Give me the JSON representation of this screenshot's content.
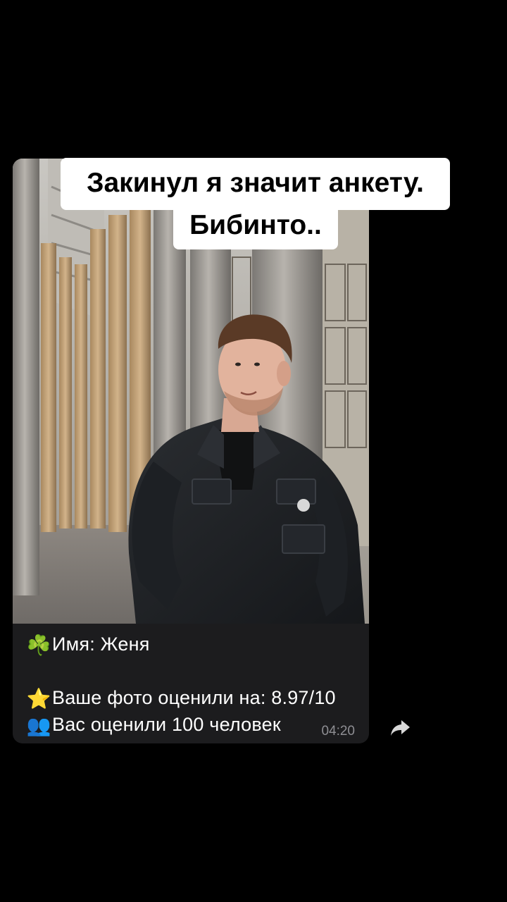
{
  "overlay": {
    "line1": "Закинул я значит анкету.",
    "line2": "Бибинто.."
  },
  "message": {
    "name_icon": "clover-icon",
    "name_emoji": "☘️",
    "name_line": "Имя: Женя",
    "rating_icon": "star-icon",
    "rating_emoji": "⭐",
    "rating_line": "Ваше фото оценили на: 8.97/10",
    "count_icon": "people-icon",
    "count_emoji": "👥",
    "count_line": "Вас оценили 100 человек",
    "time": "04:20"
  },
  "actions": {
    "forward_icon": "forward-arrow-icon"
  },
  "colors": {
    "background": "#000000",
    "bubble": "#1c1c1e",
    "caption_text": "#ffffff",
    "timestamp": "#8e8e93",
    "overlay_box": "#ffffff"
  }
}
